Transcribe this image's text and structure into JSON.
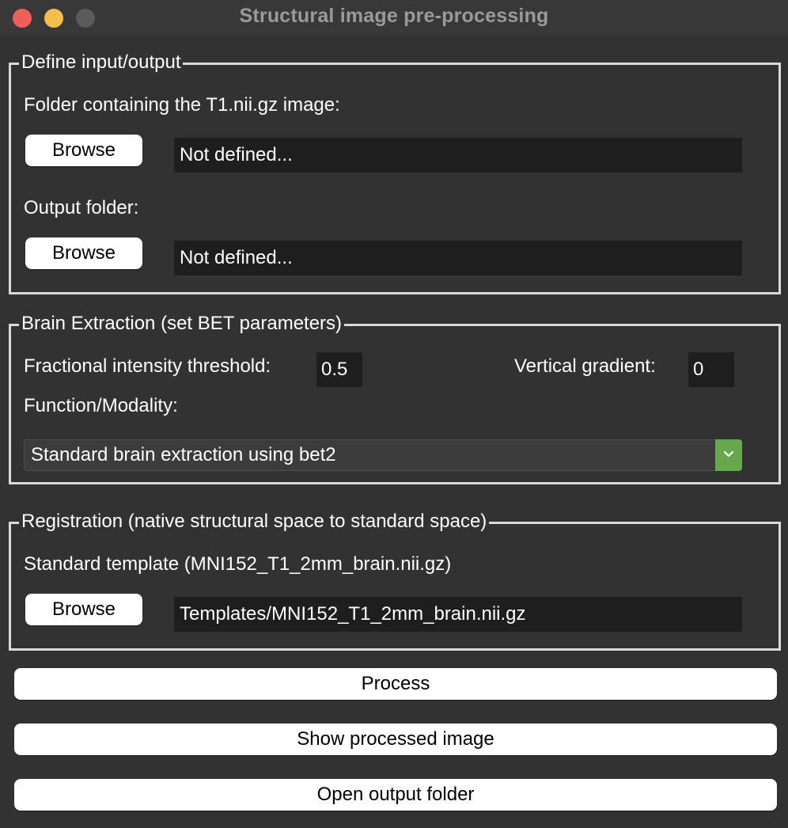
{
  "window": {
    "title": "Structural image pre-processing",
    "controls": [
      "close",
      "minimize",
      "maximize"
    ]
  },
  "io": {
    "legend": "Define input/output",
    "input_label": "Folder containing the T1.nii.gz image:",
    "input_browse": "Browse",
    "input_value": "Not defined...",
    "output_label": "Output folder:",
    "output_browse": "Browse",
    "output_value": "Not defined..."
  },
  "bet": {
    "legend": "Brain Extraction (set BET parameters)",
    "fit_label": "Fractional intensity threshold:",
    "fit_value": "0.5",
    "vgrad_label": "Vertical gradient:",
    "vgrad_value": "0",
    "modality_label": "Function/Modality:",
    "modality_selected": "Standard brain extraction using bet2"
  },
  "registration": {
    "legend": "Registration (native structural space to standard space)",
    "template_label": "Standard template (MNI152_T1_2mm_brain.nii.gz)",
    "template_browse": "Browse",
    "template_value": "Templates/MNI152_T1_2mm_brain.nii.gz"
  },
  "actions": {
    "process": "Process",
    "show": "Show processed image",
    "open": "Open output folder"
  },
  "colors": {
    "background": "#323232",
    "field": "#1e1e1e",
    "dropdown_accent": "#66a84c",
    "close": "#ee5f57",
    "minimize": "#f4be4f"
  }
}
